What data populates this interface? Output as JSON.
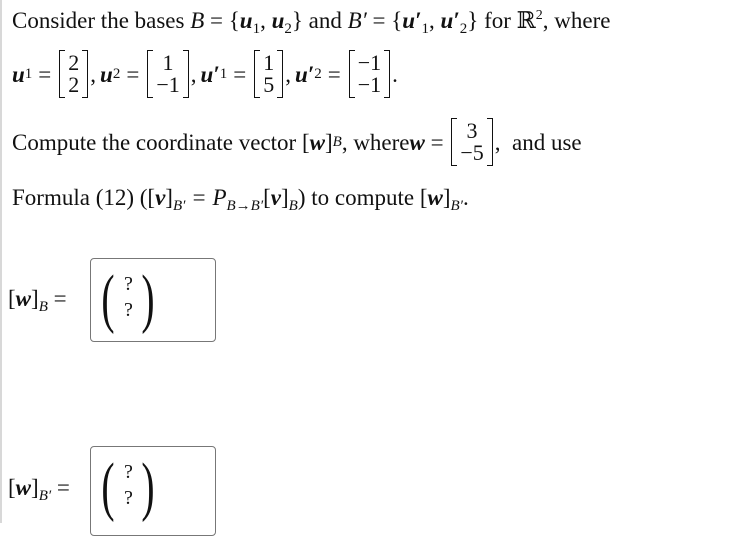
{
  "problem": {
    "line1": {
      "prefix": "Consider the bases ",
      "B": "B",
      "eq": " = {",
      "u1": "u",
      "u1_sub": "1",
      "comma": ", ",
      "u2": "u",
      "u2_sub": "2",
      "close": "} and ",
      "Bp": "B′",
      "eq2": " = {",
      "u1p": "u′",
      "u1p_sub": "1",
      "u2p": "u′",
      "u2p_sub": "2",
      "close2": "} for ",
      "R": "ℝ",
      "R_sup": "2",
      "suffix": ", where"
    },
    "vectors": [
      {
        "name": "u",
        "sub": "1",
        "prime": false,
        "values": [
          "2",
          "2"
        ]
      },
      {
        "name": "u",
        "sub": "2",
        "prime": false,
        "values": [
          "1",
          "−1"
        ]
      },
      {
        "name": "u′",
        "sub": "1",
        "prime": true,
        "values": [
          "1",
          "5"
        ]
      },
      {
        "name": "u′",
        "sub": "2",
        "prime": true,
        "values": [
          "−1",
          "−1"
        ]
      }
    ],
    "line3": {
      "prefix": "Compute the coordinate vector [",
      "w": "w",
      "sub": "B",
      "mid": ", where ",
      "w2": "w",
      "eq": " = ",
      "w_values": [
        "3",
        "−5"
      ],
      "suffix": ",  and use"
    },
    "line4": {
      "prefix": "Formula (12) ([",
      "v": "v",
      "sub1": "B′",
      "eq": " = P",
      "psub": "B→B′",
      "bracket": "[",
      "v2": "v",
      "sub2": "B",
      "mid": ") to compute [",
      "w": "w",
      "sub3": "B′",
      "suffix": "."
    }
  },
  "answers": [
    {
      "label_var": "w",
      "label_sub": "B",
      "entries": [
        "?",
        "?"
      ]
    },
    {
      "label_var": "w",
      "label_sub": "B′",
      "entries": [
        "?",
        "?"
      ]
    }
  ]
}
